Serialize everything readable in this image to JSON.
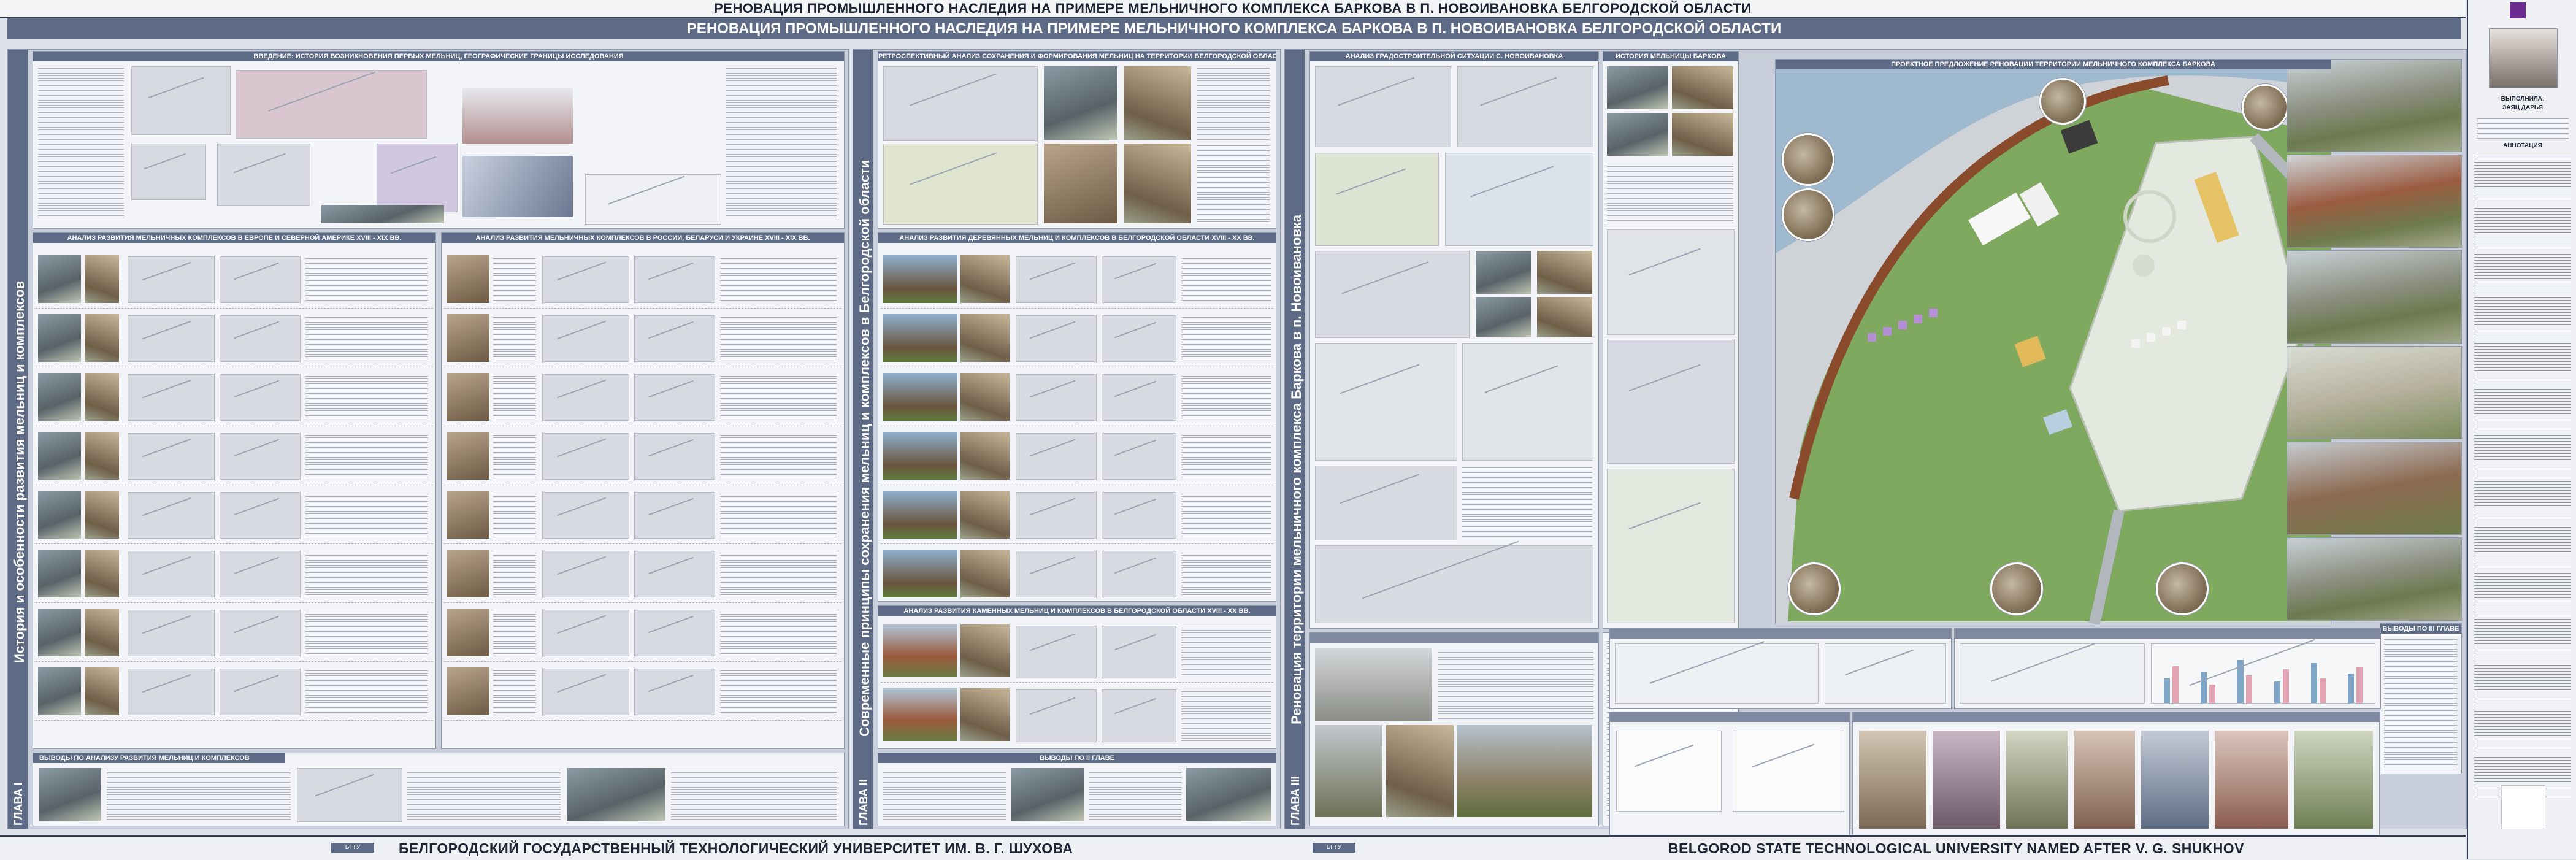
{
  "header": {
    "title_top": "РЕНОВАЦИЯ ПРОМЫШЛЕННОГО НАСЛЕДИЯ НА ПРИМЕРЕ МЕЛЬНИЧНОГО КОМПЛЕКСА БАРКОВА В П. НОВОИВАНОВКА БЕЛГОРОДСКОЙ ОБЛАСТИ",
    "title_sub": "РЕНОВАЦИЯ ПРОМЫШЛЕННОГО НАСЛЕДИЯ НА ПРИМЕРЕ МЕЛЬНИЧНОГО КОМПЛЕКСА БАРКОВА В П. НОВОИВАНОВКА БЕЛГОРОДСКОЙ ОБЛАСТИ"
  },
  "footer": {
    "left_logo": "БГТУ",
    "left_text": "БЕЛГОРОДСКИЙ ГОСУДАРСТВЕННЫЙ ТЕХНОЛОГИЧЕСКИЙ УНИВЕРСИТЕТ ИМ. В. Г. ШУХОВА",
    "right_logo": "БГТУ",
    "right_text": "BELGOROD STATE TECHNOLOGICAL UNIVERSITY NAMED AFTER V. G. SHUKHOV"
  },
  "chapters": [
    {
      "label": "ГЛАВА I",
      "strip_title": "История и особенности развития мельниц и комплексов",
      "panels": {
        "intro": "ВВЕДЕНИЕ: ИСТОРИЯ ВОЗНИКНОВЕНИЯ ПЕРВЫХ МЕЛЬНИЦ, ГЕОГРАФИЧЕСКИЕ ГРАНИЦЫ ИССЛЕДОВАНИЯ",
        "europe": "АНАЛИЗ РАЗВИТИЯ МЕЛЬНИЧНЫХ КОМПЛЕКСОВ В ЕВРОПЕ И СЕВЕРНОЙ АМЕРИКЕ XVIII - XIX ВВ.",
        "russia": "АНАЛИЗ РАЗВИТИЯ МЕЛЬНИЧНЫХ КОМПЛЕКСОВ В РОССИИ, БЕЛАРУСИ И УКРАИНЕ XVIII - XIX ВВ.",
        "conclusions": "ВЫВОДЫ ПО АНАЛИЗУ РАЗВИТИЯ МЕЛЬНИЦ И КОМПЛЕКСОВ"
      }
    },
    {
      "label": "ГЛАВА II",
      "strip_title": "Современные принципы сохранения мельниц и комплексов в Белгородской области",
      "panels": {
        "retro": "РЕТРОСПЕКТИВНЫЙ АНАЛИЗ СОХРАНЕНИЯ И ФОРМИРОВАНИЯ МЕЛЬНИЦ НА ТЕРРИТОРИИ БЕЛГОРОДСКОЙ ОБЛАСТИ",
        "wooden": "АНАЛИЗ РАЗВИТИЯ ДЕРЕВЯННЫХ МЕЛЬНИЦ И КОМПЛЕКСОВ В БЕЛГОРОДСКОЙ ОБЛАСТИ XVIII - XX ВВ.",
        "stone": "АНАЛИЗ РАЗВИТИЯ КАМЕННЫХ МЕЛЬНИЦ И КОМПЛЕКСОВ В БЕЛГОРОДСКОЙ ОБЛАСТИ XVIII - XX ВВ.",
        "conclusions": "ВЫВОДЫ ПО II ГЛАВЕ"
      }
    },
    {
      "label": "ГЛАВА III",
      "strip_title": "Реновация территории мельничного комплекса Баркова в п. Новоивановка",
      "panels": {
        "urban": "АНАЛИЗ ГРАДОСТРОИТЕЛЬНОЙ СИТУАЦИИ С. НОВОИВАНОВКА",
        "history": "ИСТОРИЯ МЕЛЬНИЦЫ БАРКОВА",
        "proposal": "ПРОЕКТНОЕ ПРЕДЛОЖЕНИЕ РЕНОВАЦИИ ТЕРРИТОРИИ МЕЛЬНИЧНОГО КОМПЛЕКСА БАРКОВА",
        "conclusions": "ВЫВОДЫ ПО III ГЛАВЕ"
      }
    }
  ],
  "sidebar": {
    "author_name_1": "ВЫПОЛНИЛА:",
    "author_name_2": "ЗАЯЦ ДАРЬЯ",
    "annotation": "АННОТАЦИЯ"
  },
  "colors": {
    "accent": "#5e6b86",
    "dark": "#2f3a53",
    "panel_bg": "#f3f4f7",
    "green": "#7ea95e",
    "river": "#9fb9cf",
    "path": "#8a4b2c",
    "purple": "#6a2c91"
  }
}
